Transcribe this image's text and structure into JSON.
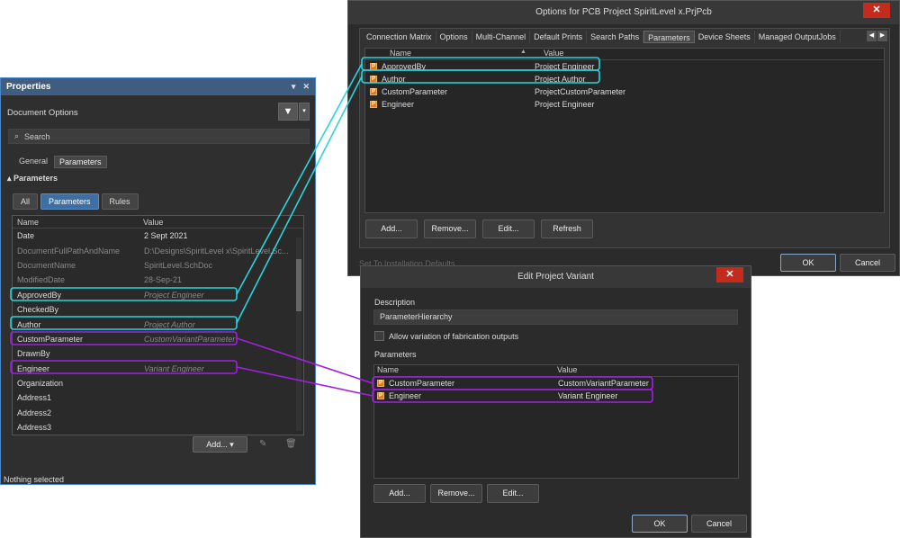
{
  "properties": {
    "title": "Properties",
    "pin_icon": "▾",
    "close_icon": "✕",
    "document_options": "Document Options",
    "filter_icon": "▼",
    "filter_dropdown_icon": "▾",
    "search_icon": "⌕",
    "search_placeholder": "Search",
    "tabs": [
      "General",
      "Parameters"
    ],
    "section_title": "▴ Parameters",
    "filter_buttons": [
      "All",
      "Parameters",
      "Rules"
    ],
    "grid_headers": {
      "name": "Name",
      "value": "Value"
    },
    "rows": [
      {
        "name": "Date",
        "value": "2 Sept 2021"
      },
      {
        "name": "DocumentFullPathAndName",
        "value": "D:\\Designs\\SpiritLevel x\\SpiritLevel.Sc..."
      },
      {
        "name": "DocumentName",
        "value": "SpiritLevel.SchDoc"
      },
      {
        "name": "ModifiedDate",
        "value": "28-Sep-21"
      },
      {
        "name": "ApprovedBy",
        "value": "Project Engineer"
      },
      {
        "name": "CheckedBy",
        "value": ""
      },
      {
        "name": "Author",
        "value": "Project Author"
      },
      {
        "name": "CustomParameter",
        "value": "CustomVariantParameter"
      },
      {
        "name": "DrawnBy",
        "value": ""
      },
      {
        "name": "Engineer",
        "value": "Variant Engineer"
      },
      {
        "name": "Organization",
        "value": ""
      },
      {
        "name": "Address1",
        "value": ""
      },
      {
        "name": "Address2",
        "value": ""
      },
      {
        "name": "Address3",
        "value": ""
      }
    ],
    "add_button": "Add... ▾",
    "edit_icon": "✎",
    "delete_icon": "🗑",
    "status": "Nothing selected"
  },
  "options_dialog": {
    "title": "Options for PCB Project SpiritLevel x.PrjPcb",
    "close_icon": "✕",
    "tabs": [
      "Connection Matrix",
      "Options",
      "Multi-Channel",
      "Default Prints",
      "Search Paths",
      "Parameters",
      "Device Sheets",
      "Managed OutputJobs"
    ],
    "tab_nav": [
      "◀",
      "▶"
    ],
    "headers": {
      "name": "Name",
      "value": "Value",
      "sort_icon": "▲"
    },
    "rows": [
      {
        "name": "ApprovedBy",
        "value": "Project Engineer"
      },
      {
        "name": "Author",
        "value": "Project Author"
      },
      {
        "name": "CustomParameter",
        "value": "ProjectCustomParameter"
      },
      {
        "name": "Engineer",
        "value": "Project Engineer"
      }
    ],
    "param_icon": "P",
    "buttons": [
      "Add...",
      "Remove...",
      "Edit...",
      "Refresh"
    ],
    "set_defaults": "Set To Installation Defaults",
    "ok": "OK",
    "cancel": "Cancel"
  },
  "variant_dialog": {
    "title": "Edit Project Variant",
    "close_icon": "✕",
    "description_label": "Description",
    "description_value": "ParameterHierarchy",
    "checkbox_label": "Allow variation of fabrication outputs",
    "parameters_label": "Parameters",
    "headers": {
      "name": "Name",
      "value": "Value"
    },
    "rows": [
      {
        "name": "CustomParameter",
        "value": "CustomVariantParameter"
      },
      {
        "name": "Engineer",
        "value": "Variant Engineer"
      }
    ],
    "param_icon": "P",
    "buttons": [
      "Add...",
      "Remove...",
      "Edit..."
    ],
    "ok": "OK",
    "cancel": "Cancel"
  },
  "colors": {
    "project_highlight": "#2ad4dc",
    "variant_highlight": "#a020e0"
  }
}
